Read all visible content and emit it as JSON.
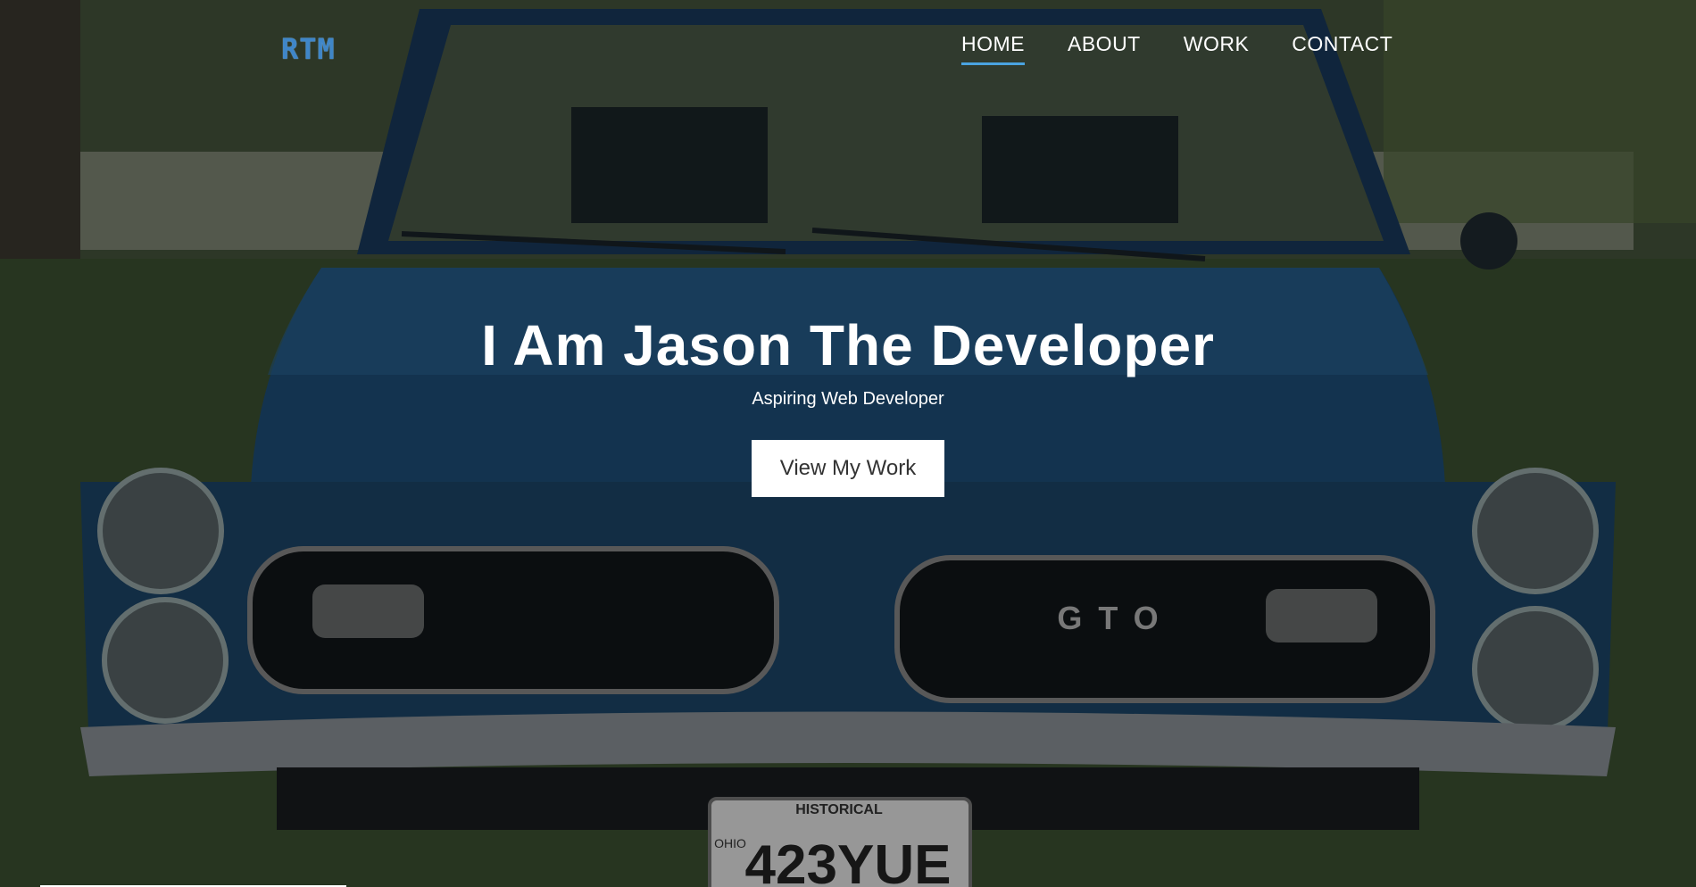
{
  "logo": {
    "text": "RTM"
  },
  "nav": {
    "items": [
      {
        "label": "HOME",
        "active": true
      },
      {
        "label": "ABOUT",
        "active": false
      },
      {
        "label": "WORK",
        "active": false
      },
      {
        "label": "CONTACT",
        "active": false
      }
    ]
  },
  "hero": {
    "title": "I Am Jason The Developer",
    "subtitle": "Aspiring Web Developer",
    "cta_label": "View My Work",
    "background": {
      "grille_text": "G T O",
      "plate_top": "HISTORICAL",
      "plate_number": "423YUE",
      "plate_state": "OHIO"
    }
  },
  "colors": {
    "accent": "#4aa3e0",
    "logo": "#3f86c8",
    "car_body": "#1e4f7a"
  }
}
